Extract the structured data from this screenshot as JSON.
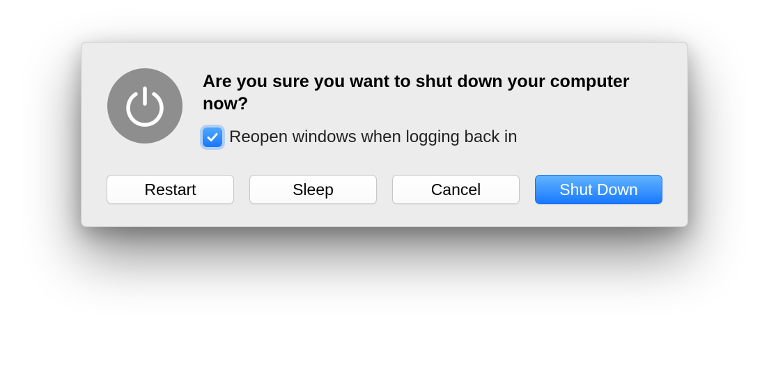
{
  "dialog": {
    "title": "Are you sure you want to shut down your computer now?",
    "checkbox": {
      "label": "Reopen windows when logging back in",
      "checked": true
    },
    "buttons": {
      "restart": "Restart",
      "sleep": "Sleep",
      "cancel": "Cancel",
      "shutdown": "Shut Down"
    },
    "icon": "power-icon"
  }
}
